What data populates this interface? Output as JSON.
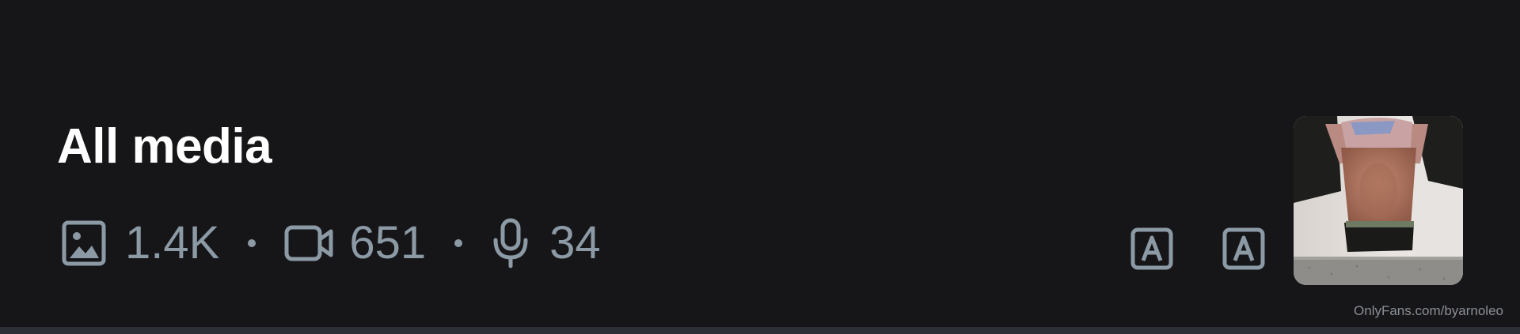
{
  "header": {
    "title": "All media"
  },
  "stats": {
    "photos": {
      "icon": "image-icon",
      "value": "1.4K"
    },
    "videos": {
      "icon": "video-camera-icon",
      "value": "651"
    },
    "audio": {
      "icon": "microphone-icon",
      "value": "34"
    }
  },
  "toolbar": {
    "buttons": [
      {
        "icon": "auto-translate-icon"
      },
      {
        "icon": "auto-translate-icon"
      }
    ]
  },
  "preview": {
    "thumbnail": "media-thumbnail"
  },
  "watermark": {
    "text": "OnlyFans.com/byarnoleo"
  },
  "colors": {
    "background": "#161618",
    "title": "#ffffff",
    "muted": "#8c9aa6",
    "watermark": "#8a8e94"
  }
}
